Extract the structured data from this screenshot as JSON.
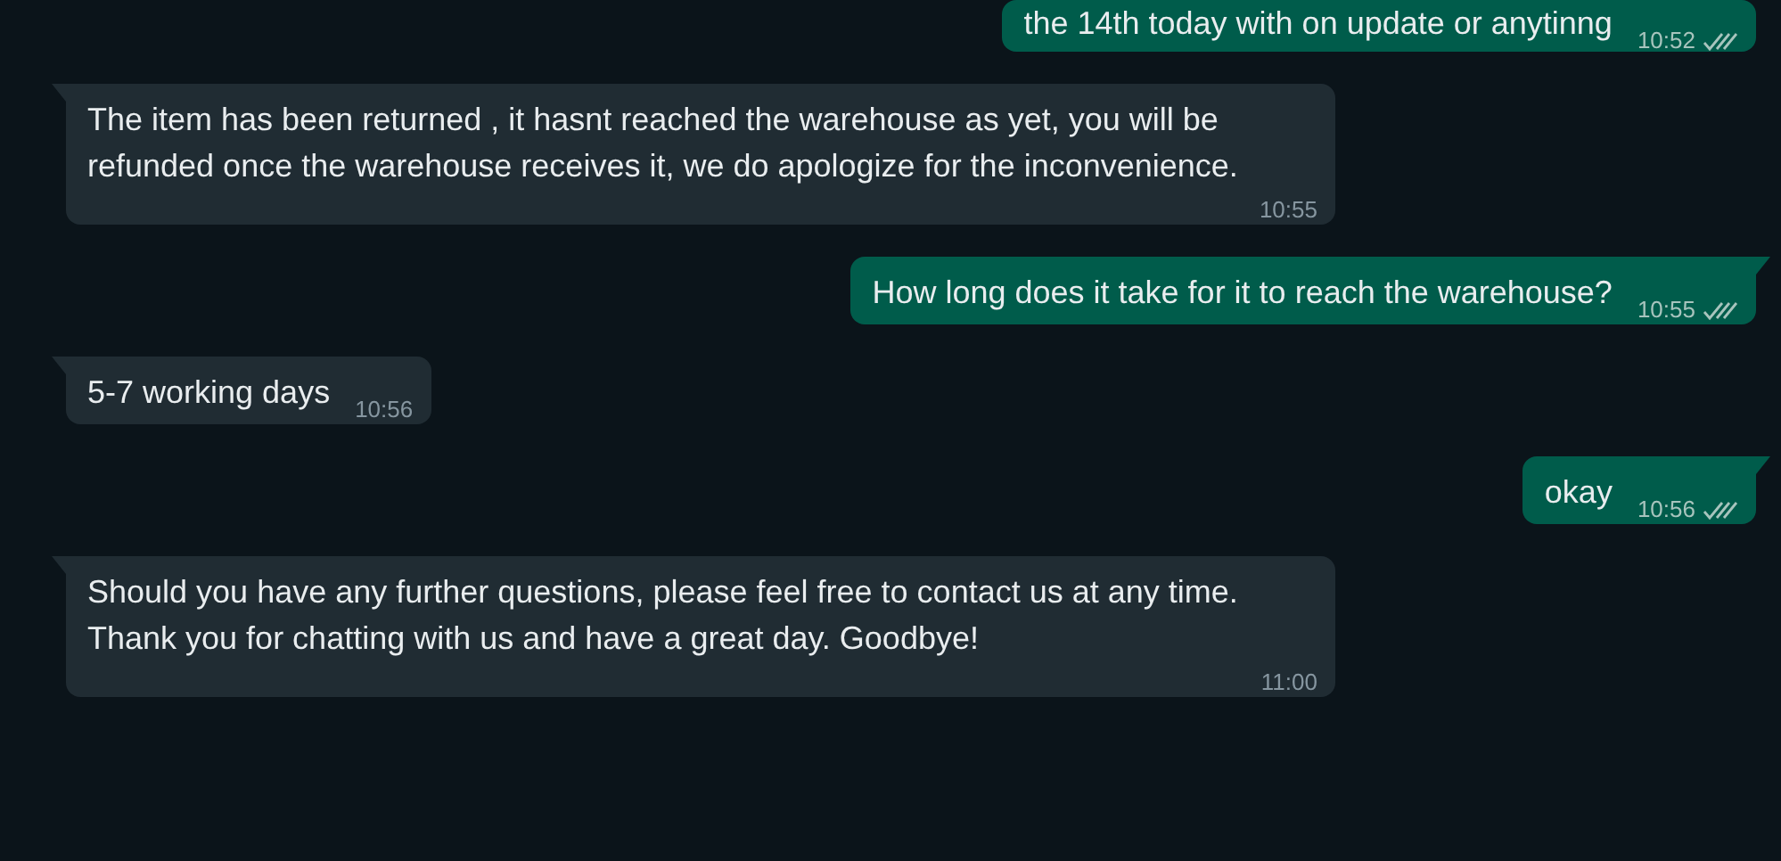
{
  "messages": [
    {
      "outgoing": true,
      "text": "the 14th today with on update or anytinng",
      "time": "10:52",
      "read": false,
      "tail": false
    },
    {
      "outgoing": false,
      "text": "The item has been returned , it hasnt reached the warehouse as yet, you will be refunded once the warehouse receives it, we do apologize for the inconvenience.",
      "time": "10:55",
      "tail": true
    },
    {
      "outgoing": true,
      "text": "How long does it take for it to reach the warehouse?",
      "time": "10:55",
      "read": false,
      "tail": true
    },
    {
      "outgoing": false,
      "text": "5-7 working days",
      "time": "10:56",
      "tail": true
    },
    {
      "outgoing": true,
      "text": "okay",
      "time": "10:56",
      "read": false,
      "tail": true
    },
    {
      "outgoing": false,
      "text": "Should you have any further questions, please feel free to contact us at any time. Thank you for chatting with us and have a great day. Goodbye!",
      "time": "11:00",
      "tail": true
    }
  ]
}
